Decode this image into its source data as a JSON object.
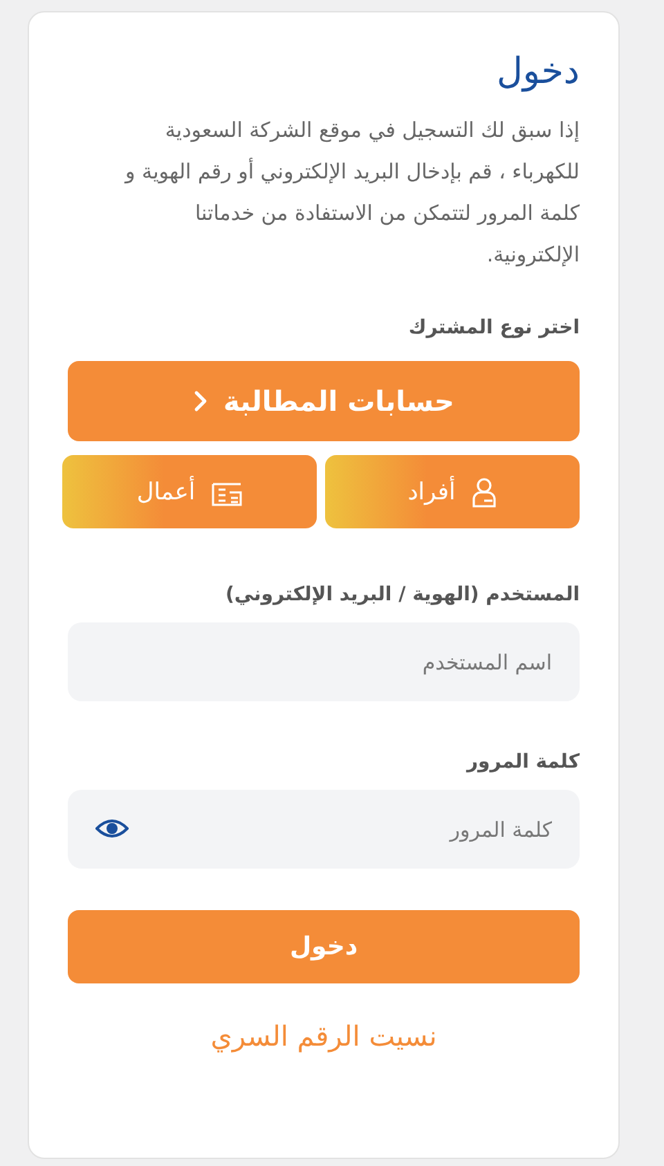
{
  "title": "دخول",
  "intro": "إذا سبق لك التسجيل في موقع الشركة السعودية للكهرباء ، قم بإدخال البريد الإلكتروني أو رقم الهوية و كلمة المرور لتتمكن من الاستفادة من خدماتنا الإلكترونية.",
  "subscriber_type": {
    "label": "اختر نوع المشترك",
    "claims_button": "حسابات المطالبة",
    "options": [
      {
        "label": "أفراد",
        "kind": "person",
        "selected": false
      },
      {
        "label": "أعمال",
        "kind": "business",
        "selected": false
      }
    ]
  },
  "username": {
    "label": "المستخدم (الهوية / البريد الإلكتروني)",
    "placeholder": "اسم المستخدم"
  },
  "password": {
    "label": "كلمة المرور",
    "placeholder": "كلمة المرور"
  },
  "login_button": "دخول",
  "forgot_link": "نسيت الرقم السري"
}
